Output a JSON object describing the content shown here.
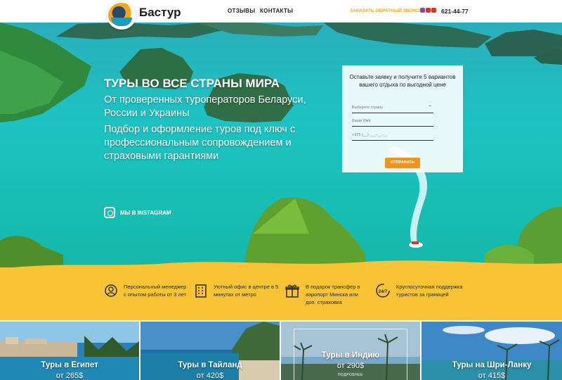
{
  "header": {
    "brand": "Бастур",
    "nav": [
      "ОТЗЫВЫ",
      "КОНТАКТЫ"
    ],
    "callback_label": "ЗАКАЗАТЬ ОБРАТНЫЙ ЗВОНОК",
    "phone": "621-44-77",
    "messenger_icons": [
      "viber-icon",
      "telegram-icon",
      "whatsapp-icon"
    ]
  },
  "hero": {
    "title": "ТУРЫ ВО ВСЕ СТРАНЫ МИРА",
    "subtitle": "От проверенных туроператоров Беларуси, России и Украины",
    "description": "Подбор и оформление туров под ключ с профессиональным сопровождением и страховыми гарантиями",
    "instagram_label": "МЫ В INSTAGRAM"
  },
  "form": {
    "title": "Оставьте заявку и получите 5 вариантов вашего отдыха по выгодной цене",
    "country_placeholder": "Выберете страну",
    "name_placeholder": "Ваше Имя",
    "phone_placeholder": "+375 (__) ___-__-__",
    "submit_label": "ОТПРАВИТЬ"
  },
  "features": [
    {
      "icon": "manager-icon",
      "text": "Персональный менеджер с опытом работы от 3 лет"
    },
    {
      "icon": "office-icon",
      "text": "Уютный офис в центре в 5 минутах от метро"
    },
    {
      "icon": "gift-icon",
      "text": "В подарок трансфер в аэропорт Минска или доп. страховка"
    },
    {
      "icon": "support-24-7-icon",
      "text": "Круглосуточная поддержка туристов за границей",
      "badge": "24/7"
    }
  ],
  "tours": [
    {
      "title": "Туры в Египет",
      "price": "от 265$"
    },
    {
      "title": "Туры в Тайланд",
      "price": "от 420$"
    },
    {
      "title": "Туры в Индию",
      "price": "от 290$",
      "more": "ПОДРОБНЕЕ"
    },
    {
      "title": "Туры на Шри-Ланку",
      "price": "от 415$"
    }
  ],
  "colors": {
    "accent_yellow": "#f8c334",
    "button_orange": "#f0941e",
    "callback_orange": "#f3a51b",
    "sea": "#16c2b8"
  }
}
